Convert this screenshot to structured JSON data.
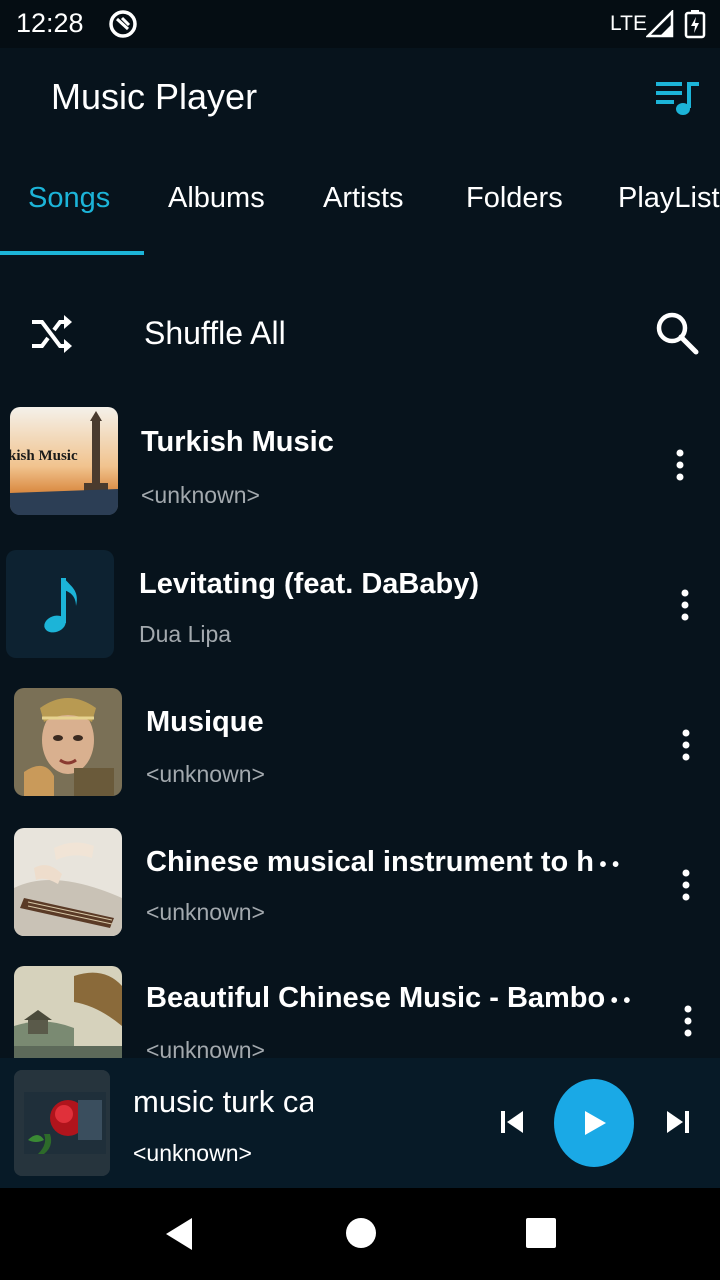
{
  "status": {
    "time": "12:28",
    "network": "LTE",
    "icons": [
      "app-notification-icon",
      "signal-icon",
      "battery-charging-icon"
    ]
  },
  "app_bar": {
    "title": "Music Player",
    "action_icon": "queue-music-icon"
  },
  "tabs": [
    {
      "label": "Songs",
      "active": true
    },
    {
      "label": "Albums",
      "active": false
    },
    {
      "label": "Artists",
      "active": false
    },
    {
      "label": "Folders",
      "active": false
    },
    {
      "label": "PlayList",
      "active": false
    }
  ],
  "shuffle": {
    "label": "Shuffle All",
    "icon": "shuffle-icon",
    "search_icon": "search-icon"
  },
  "songs": [
    {
      "title": "Turkish Music",
      "artist": "<unknown>",
      "art_text": "kish Music"
    },
    {
      "title": "Levitating (feat. DaBaby)",
      "artist": "Dua Lipa",
      "art_icon": "music-note-icon"
    },
    {
      "title": "Musique",
      "artist": "<unknown>"
    },
    {
      "title": "Chinese musical instrument to h",
      "artist": "<unknown>"
    },
    {
      "title": "Beautiful Chinese Music - Bambo",
      "artist": "<unknown>"
    }
  ],
  "mini_player": {
    "title": "music turk ca",
    "artist": "<unknown>",
    "controls": [
      "skip-previous-icon",
      "play-icon",
      "skip-next-icon"
    ]
  },
  "colors": {
    "accent": "#1cb4d8",
    "background": "#07131c",
    "mini_player_bg": "#071a27",
    "play_button": "#1aa9e6"
  }
}
